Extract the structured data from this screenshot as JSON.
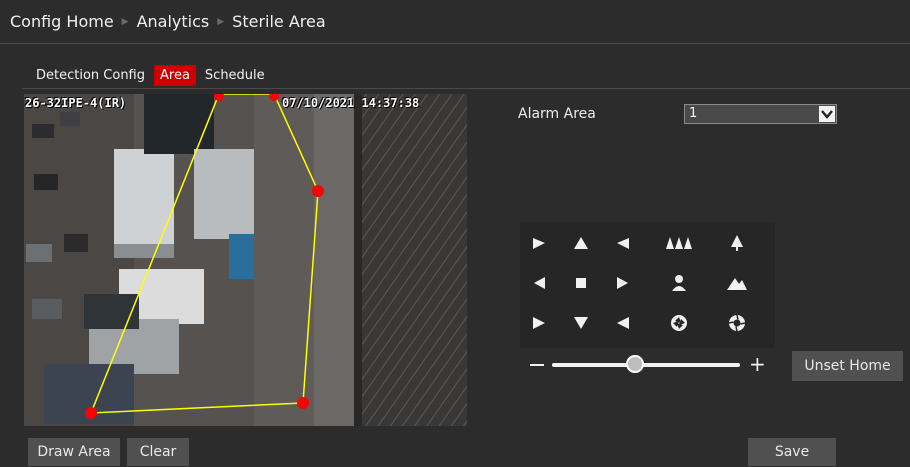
{
  "breadcrumb": [
    "Config Home",
    "Analytics",
    "Sterile Area"
  ],
  "tabs": [
    {
      "label": "Detection Config",
      "active": false
    },
    {
      "label": "Area",
      "active": true
    },
    {
      "label": "Schedule",
      "active": false
    }
  ],
  "video": {
    "osd_camera": "26-32IPE-4(IR)",
    "osd_datetime": "07/10/2021 14:37:38"
  },
  "alarm_area": {
    "label": "Alarm Area",
    "value": "1"
  },
  "ptz_buttons": [
    "arrow-up-left-icon",
    "arrow-up-icon",
    "arrow-up-right-icon",
    "zoom-out-trees-icon",
    "zoom-in-tree-icon",
    "arrow-left-icon",
    "stop-icon",
    "arrow-right-icon",
    "person-icon",
    "mountain-icon",
    "arrow-down-left-icon",
    "arrow-down-icon",
    "arrow-down-right-icon",
    "iris-close-icon",
    "iris-open-icon"
  ],
  "speed": {
    "min_symbol": "—",
    "max_symbol": "+",
    "level": 0.44
  },
  "buttons": {
    "unset_home": "Unset Home",
    "draw_area": "Draw Area",
    "clear": "Clear",
    "save": "Save"
  },
  "colors": {
    "accent_red": "#cc0000",
    "area_line": "#ffff00",
    "area_point": "#ff0000"
  }
}
